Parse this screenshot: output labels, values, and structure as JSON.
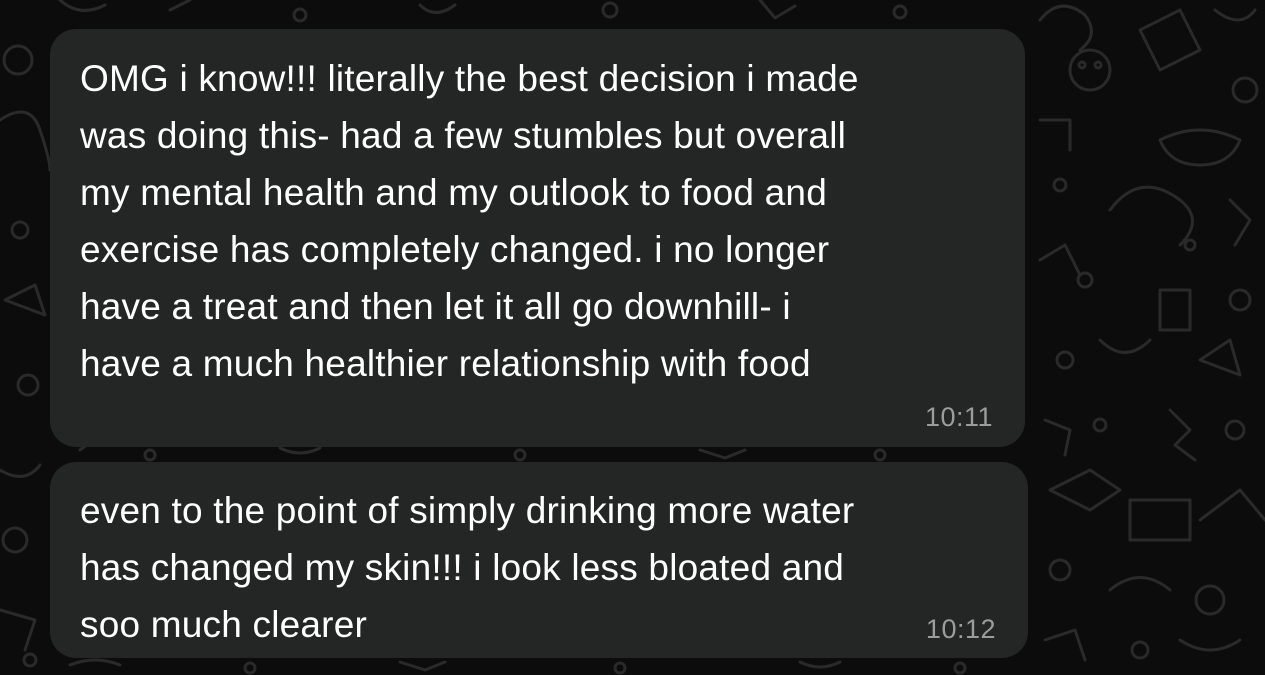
{
  "messages": [
    {
      "lines": [
        "OMG i know!!! literally the best decision i made",
        "was doing this- had a few stumbles but overall",
        "my mental health and my outlook to food and",
        "exercise has completely changed. i no longer",
        "have a treat and then let it all go downhill- i",
        "have a much healthier relationship with food"
      ],
      "time": "10:11"
    },
    {
      "lines": [
        "even to the point of simply drinking more water",
        "has changed my skin!!! i look less bloated and",
        "soo much clearer"
      ],
      "time": "10:12"
    }
  ],
  "colors": {
    "background": "#0c0c0c",
    "bubble": "#242525",
    "text": "#ffffff",
    "timestamp": "#9c9c9c",
    "doodle": "#2a2a2a"
  }
}
